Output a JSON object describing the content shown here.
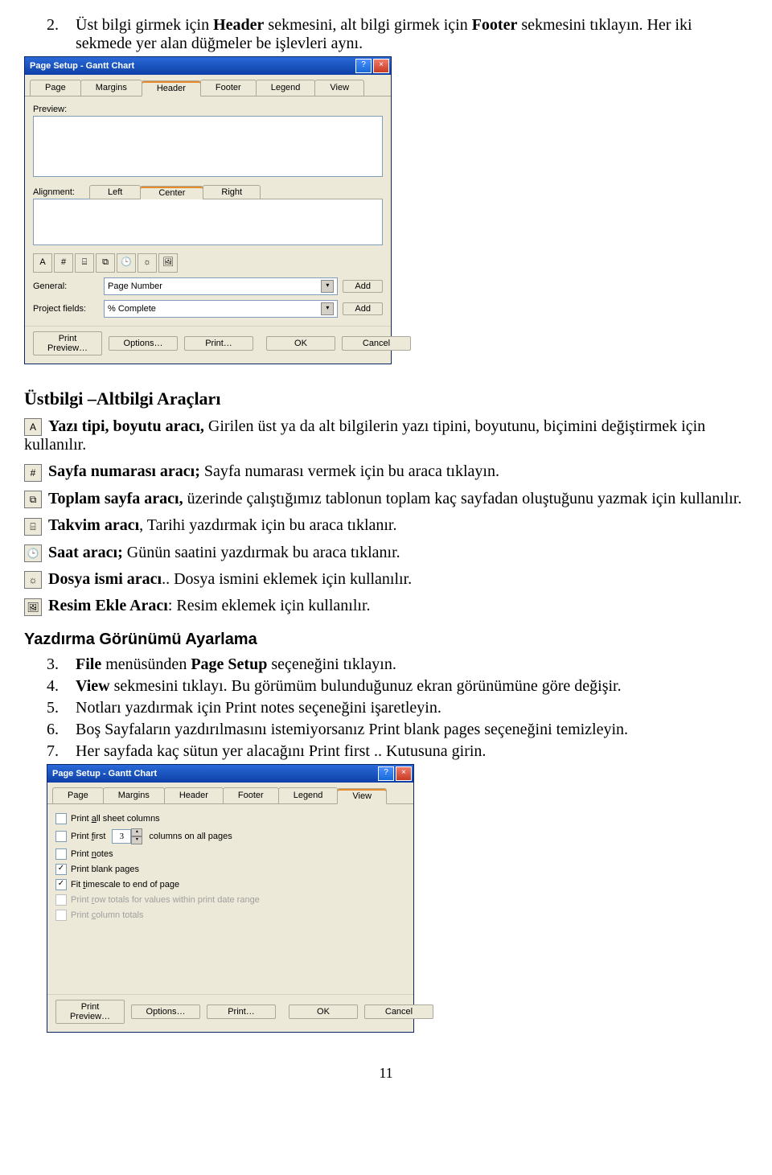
{
  "step2": {
    "num": "2.",
    "pre": "Üst bilgi girmek için ",
    "h": "Header",
    "mid": " sekmesini, alt bilgi girmek için ",
    "f": "Footer",
    "post": " sekmesini tıklayın. Her iki sekmede yer alan düğmeler be işlevleri aynı."
  },
  "dlg1": {
    "title": "Page Setup - Gantt Chart",
    "help": "?",
    "close": "×",
    "tabs": {
      "page": "Page",
      "margins": "Margins",
      "header": "Header",
      "footer": "Footer",
      "legend": "Legend",
      "view": "View"
    },
    "preview": "Preview:",
    "alignment": "Alignment:",
    "align": {
      "left": "Left",
      "center": "Center",
      "right": "Right"
    },
    "icons": {
      "a": "A",
      "b": "#",
      "c": "⌸",
      "d": "⧉",
      "e": "🕒",
      "f": "☼",
      "g": "🖼"
    },
    "general_label": "General:",
    "general_value": "Page Number",
    "project_label": "Project fields:",
    "project_value": "% Complete",
    "add": "Add",
    "footer": {
      "preview": "Print Preview…",
      "options": "Options…",
      "print": "Print…",
      "ok": "OK",
      "cancel": "Cancel"
    }
  },
  "tools_heading": "Üstbilgi –Altbilgi Araçları",
  "tools": {
    "font": {
      "icon": "A",
      "b": "Yazı tipi, boyutu aracı,",
      "t": "  Girilen üst ya da alt bilgilerin yazı tipini, boyutunu, biçimini değiştirmek için kullanılır."
    },
    "pagenum": {
      "icon": "#",
      "b": "Sayfa numarası aracı;",
      "t": " Sayfa numarası vermek için bu araca tıklayın."
    },
    "pagecount": {
      "icon": "⧉",
      "b": "Toplam sayfa aracı,",
      "t": "  üzerinde çalıştığımız tablonun toplam kaç sayfadan oluştuğunu yazmak için kullanılır."
    },
    "date": {
      "icon": "⌸",
      "b": "Takvim aracı",
      "t": ", Tarihi yazdırmak için bu araca tıklanır."
    },
    "time": {
      "icon": "🕒",
      "b": "Saat aracı;",
      "t": "  Günün saatini yazdırmak bu araca tıklanır."
    },
    "file": {
      "icon": "☼",
      "b": "Dosya ismi aracı",
      "t": ".. Dosya ismini eklemek için kullanılır."
    },
    "pic": {
      "icon": "🖼",
      "b": "Resim Ekle Aracı",
      "t": ": Resim eklemek için kullanılır."
    }
  },
  "sub_heading": "Yazdırma Görünümü Ayarlama",
  "steps": {
    "s3": {
      "n": "3.",
      "pre": "",
      "b": "File",
      "mid": " menüsünden ",
      "b2": "Page Setup",
      "post": " seçeneğini tıklayın."
    },
    "s4": {
      "n": "4.",
      "pre": "",
      "b": "View",
      "post": " sekmesini tıklayı. Bu görümüm bulunduğunuz ekran görünümüne göre değişir."
    },
    "s5": {
      "n": "5.",
      "t": "Notları yazdırmak için Print notes seçeneğini işaretleyin."
    },
    "s6": {
      "n": "6.",
      "t": "Boş Sayfaların yazdırılmasını istemiyorsanız Print blank pages seçeneğini temizleyin."
    },
    "s7": {
      "n": "7.",
      "t": "Her sayfada kaç sütun yer alacağını  Print first .. Kutusuna girin."
    }
  },
  "dlg2": {
    "title": "Page Setup - Gantt Chart",
    "tabs": {
      "page": "Page",
      "margins": "Margins",
      "header": "Header",
      "footer": "Footer",
      "legend": "Legend",
      "view": "View"
    },
    "c1": "Print all sheet columns",
    "c2a": "Print first",
    "c2val": "3",
    "c2b": "columns on all pages",
    "c3": "Print notes",
    "c4": "Print blank pages",
    "c5": "Fit timescale to end of page",
    "c6": "Print row totals for values within print date range",
    "c7": "Print column totals",
    "footer": {
      "preview": "Print Preview…",
      "options": "Options…",
      "print": "Print…",
      "ok": "OK",
      "cancel": "Cancel"
    }
  },
  "page_number": "11"
}
